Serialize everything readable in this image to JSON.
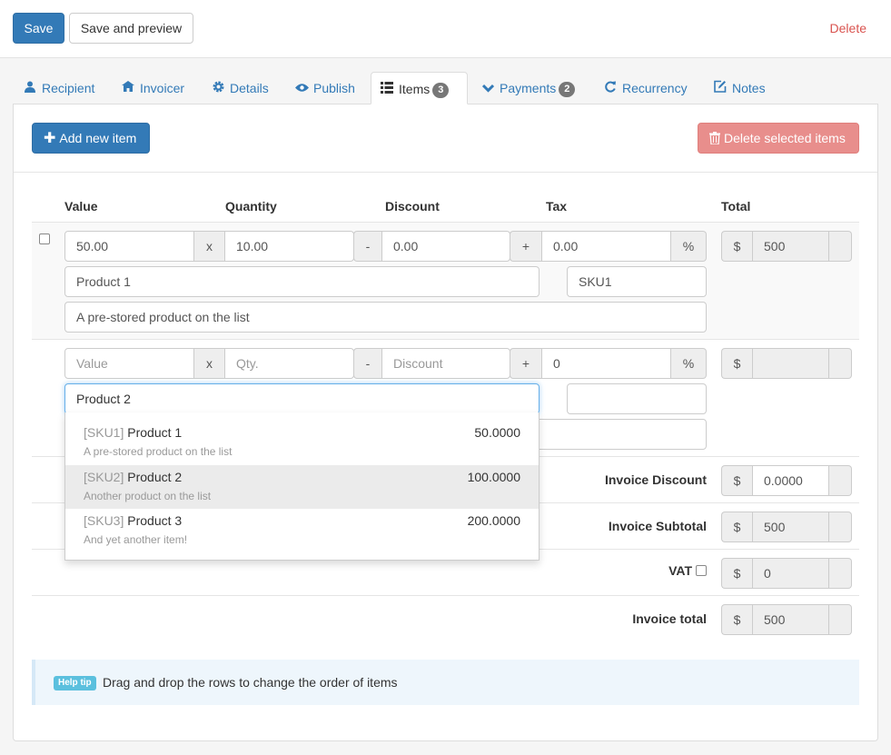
{
  "toolbar": {
    "save_label": "Save",
    "save_preview_label": "Save and preview",
    "delete_label": "Delete"
  },
  "tabs": [
    {
      "label": "Recipient",
      "icon": "user-icon"
    },
    {
      "label": "Invoicer",
      "icon": "bank-icon"
    },
    {
      "label": "Details",
      "icon": "gear-icon"
    },
    {
      "label": "Publish",
      "icon": "eye-icon"
    },
    {
      "label": "Items",
      "icon": "list-icon",
      "badge": "3",
      "active": true
    },
    {
      "label": "Payments",
      "icon": "chevron-down-icon",
      "badge": "2"
    },
    {
      "label": "Recurrency",
      "icon": "refresh-icon"
    },
    {
      "label": "Notes",
      "icon": "edit-icon"
    }
  ],
  "actions": {
    "add_item_label": "Add new item",
    "delete_selected_label": "Delete selected items"
  },
  "columns": {
    "value": "Value",
    "quantity": "Quantity",
    "discount": "Discount",
    "tax": "Tax",
    "total": "Total"
  },
  "symbols": {
    "times": "x",
    "minus": "-",
    "plus": "+",
    "percent": "%",
    "currency": "$"
  },
  "items": [
    {
      "value": "50.00",
      "quantity": "10.00",
      "discount": "0.00",
      "tax": "0.00",
      "total": "500",
      "name": "Product 1",
      "sku": "SKU1",
      "description": "A pre-stored product on the list"
    },
    {
      "value_placeholder": "Value",
      "quantity_placeholder": "Qty.",
      "discount_placeholder": "Discount",
      "tax": "0",
      "total": "",
      "name": "Product 2",
      "sku": "",
      "description": ""
    }
  ],
  "autocomplete": [
    {
      "sku": "[SKU1]",
      "name": "Product 1",
      "price": "50.0000",
      "description": "A pre-stored product on the list"
    },
    {
      "sku": "[SKU2]",
      "name": "Product 2",
      "price": "100.0000",
      "description": "Another product on the list",
      "highlighted": true
    },
    {
      "sku": "[SKU3]",
      "name": "Product 3",
      "price": "200.0000",
      "description": "And yet another item!"
    }
  ],
  "summary": {
    "discount_label": "Invoice Discount",
    "discount_value": "0.0000",
    "subtotal_label": "Invoice Subtotal",
    "subtotal_value": "500",
    "vat_label": "VAT",
    "vat_value": "0",
    "total_label": "Invoice total",
    "total_value": "500"
  },
  "help": {
    "badge": "Help tip",
    "text": "Drag and drop the rows to change the order of items"
  }
}
